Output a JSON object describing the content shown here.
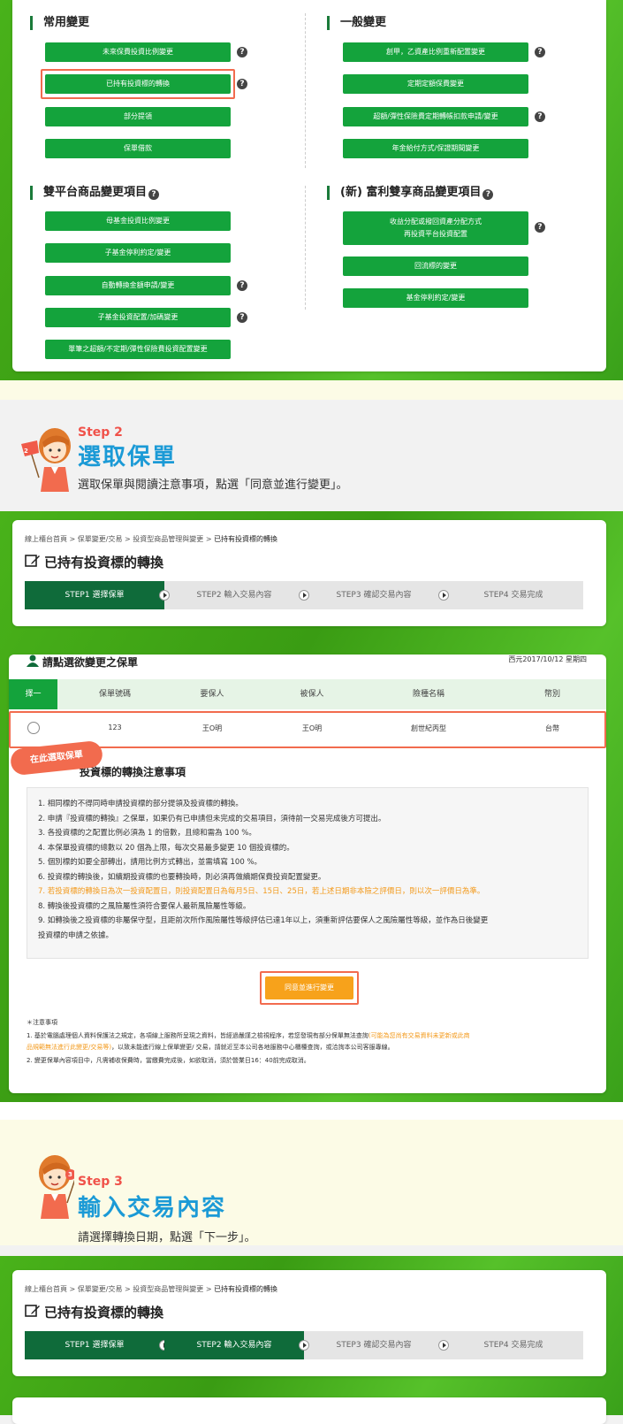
{
  "panel1": {
    "common": {
      "title": "常用變更",
      "buttons": [
        "未來保費投資比例變更",
        "已持有投資標的轉換",
        "部分提領",
        "保單借款"
      ]
    },
    "general": {
      "title": "一般變更",
      "buttons": [
        "創甲，乙資產比例重新配置變更",
        "定期定額保費變更",
        "超額/彈性保險費定期轉帳扣款申請/變更",
        "年金給付方式/保證期間變更"
      ]
    },
    "dual": {
      "title": "雙平台商品變更項目",
      "buttons": [
        "母基金投資比例變更",
        "子基金停利約定/變更",
        "自動轉換金額申請/變更",
        "子基金投資配置/加碼變更",
        "單筆之超額/不定期/彈性保險費投資配置變更"
      ]
    },
    "fuli": {
      "title": "(新) 富利雙享商品變更項目",
      "buttons": [
        "收益分配或撥回資產分配方式",
        "再投資平台投資配置",
        "回流標的變更",
        "基金停利約定/變更"
      ]
    },
    "help_glyph": "?"
  },
  "step2": {
    "label": "Step 2",
    "title": "選取保單",
    "desc": "選取保單與閱讀注意事項，點選「同意並進行變更」。",
    "badge": "2"
  },
  "step3": {
    "label": "Step 3",
    "title": "輸入交易內容",
    "desc": "請選擇轉換日期，點選「下一步」。",
    "badge": "3"
  },
  "page": {
    "breadcrumb": "線上櫃台首頁 > 保單變更/交易 > 投資型商品管理與變更 > ",
    "breadcrumb_current": "已持有投資標的轉換",
    "title": "已持有投資標的轉換",
    "steps": [
      "STEP1 選擇保單",
      "STEP2 輸入交易內容",
      "STEP3 確認交易內容",
      "STEP4 交易完成"
    ]
  },
  "policy": {
    "heading": "請點選欲變更之保單",
    "date": "西元2017/10/12 星期四",
    "columns": [
      "擇一",
      "保單號碼",
      "要保人",
      "被保人",
      "險種名稱",
      "幣別"
    ],
    "row": [
      "123",
      "王O明",
      "王O明",
      "創世紀丙型",
      "台幣"
    ],
    "callout": "在此選取保單"
  },
  "notice": {
    "title": "投資標的轉換注意事項",
    "items": [
      {
        "text": "1. 相同標的不得同時申請投資標的部分提領及投資標的轉換。",
        "color": "#333333"
      },
      {
        "text": "2. 申請『投資標的轉換』之保單，如果仍有已申請但未完成的交易項目，須待前一交易完成後方可提出。",
        "color": "#333333"
      },
      {
        "text": "3. 各投資標的之配置比例必須為 1 的倍數，且總和需為 100 %。",
        "color": "#333333"
      },
      {
        "text": "4. 本保單投資標的總數以 20 個為上限，每次交易最多變更 10 個投資標的。",
        "color": "#333333"
      },
      {
        "text": "5. 個別標的如要全部轉出，請用比例方式轉出，並需填寫 100 %。",
        "color": "#333333"
      },
      {
        "text": "6. 投資標的轉換後，如續期投資標的也要轉換時，則必須再做續期保費投資配置變更。",
        "color": "#333333"
      },
      {
        "text": "7. 若投資標的轉換日為次一投資配置日，則投資配置日為每月5日、15日、25日，若上述日期非本險之評價日，則以次一評價日為準。",
        "color": "#f39a1c"
      },
      {
        "text": "8. 轉換後投資標的之風險屬性須符合要保人最新風險屬性等級。",
        "color": "#333333"
      },
      {
        "text": "9. 如轉換後之投資標的非屬保守型，且距前次所作風險屬性等級評估已達1年以上，須重新評估要保人之風險屬性等級，並作為日後變更",
        "color": "#333333"
      },
      {
        "text": "    投資標的申請之依據。",
        "color": "#333333"
      }
    ],
    "agree_button": "同意並進行變更"
  },
  "footnotes": {
    "title": "＊注意事項",
    "line1a": "1. 基於電腦處理個人資料保護法之規定，各項線上服務所呈現之資料，皆經過嚴謹之檢視程序，若您發現有部分保單無法查詢",
    "line1b": "(可能為您尚有交易資料未更新或此商",
    "line1c": "品規範無法進行此變更/交易等)",
    "line1d": "，以致未能進行線上保單變更/ 交易，請就近至本公司各地服務中心櫃檯查詢，或洽詢本公司客服專線。",
    "line2": "2. 變更保單內容項目中，凡需補收保費時，當繳費完成後，如欲取消，須於營業日16：40前完成取消。"
  },
  "colors": {
    "green_button": "#14a33c",
    "dark_green_step": "#0f6b3a",
    "accent_red": "#f26b4e",
    "step_blue": "#1b9ad6",
    "orange_button": "#f7a21b"
  }
}
